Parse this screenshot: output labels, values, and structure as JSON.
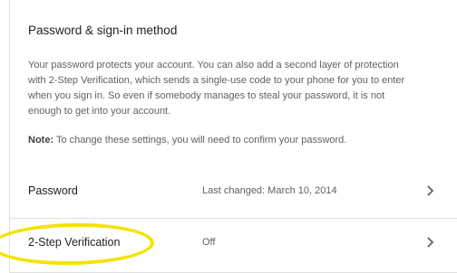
{
  "section": {
    "title": "Password & sign-in method",
    "description": "Your password protects your account. You can also add a second layer of protection with 2-Step Verification, which sends a single-use code to your phone for you to enter when you sign in. So even if somebody manages to steal your password, it is not enough to get into your account.",
    "note_label": "Note:",
    "note_text": " To change these settings, you will need to confirm your password."
  },
  "rows": [
    {
      "label": "Password",
      "value": "Last changed: March 10, 2014",
      "icon": "chevron-right-icon"
    },
    {
      "label": "2-Step Verification",
      "value": "Off",
      "icon": "chevron-right-icon"
    }
  ],
  "colors": {
    "highlight": "#f5e200",
    "divider": "#e0e0e0",
    "text_primary": "#212121",
    "text_secondary": "#616161"
  }
}
